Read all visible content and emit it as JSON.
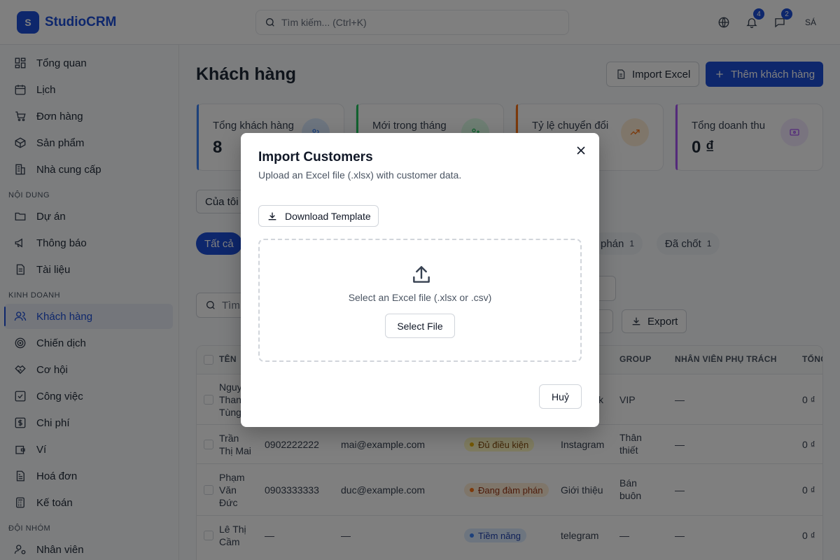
{
  "header": {
    "logo_letter": "S",
    "app_name": "StudioCRM",
    "search_placeholder": "Tìm kiếm... (Ctrl+K)",
    "notifications_count": "4",
    "messages_count": "2",
    "user_initials": "SÁ"
  },
  "sidebar": {
    "items_top": [
      "Tổng quan",
      "Lịch",
      "Đơn hàng",
      "Sản phẩm",
      "Nhà cung cấp"
    ],
    "section_content": "NỘI DUNG",
    "items_content": [
      "Dự án",
      "Thông báo",
      "Tài liệu"
    ],
    "section_business": "KINH DOANH",
    "items_business": [
      "Khách hàng",
      "Chiến dịch",
      "Cơ hội",
      "Công việc",
      "Chi phí",
      "Ví",
      "Hoá đơn",
      "Kế toán"
    ],
    "section_team": "ĐỘI NHÓM",
    "items_team": [
      "Nhân viên"
    ],
    "active_item": "Khách hàng"
  },
  "page": {
    "title": "Khách hàng",
    "import_label": "Import Excel",
    "add_label": "Thêm khách hàng",
    "stats": [
      {
        "label": "Tổng khách hàng",
        "value": "8"
      },
      {
        "label": "Mới trong tháng",
        "value": ""
      },
      {
        "label": "Tỷ lệ chuyển đổi",
        "value": ""
      },
      {
        "label": "Tổng doanh thu",
        "value": "0 ₫"
      }
    ],
    "filter_mine": "Của tôi",
    "tab_all": "Tất cả",
    "tab_negotiating": "phán",
    "tab_negotiating_count": "1",
    "tab_closed": "Đã chốt",
    "tab_closed_count": "1",
    "search_short": "Tìm",
    "export_label": "Export"
  },
  "table": {
    "headers": {
      "name": "TÊN",
      "group": "GROUP",
      "staff": "NHÂN VIÊN PHỤ TRÁCH",
      "total": "TỔNG"
    },
    "rows": [
      {
        "name": "Nguy Thanh Tùng",
        "name_lines": [
          "Nguy",
          "Thanh",
          "Tùng"
        ],
        "phone": "",
        "email": "",
        "status": "",
        "source": "k",
        "group": "VIP",
        "group_lines": [
          "VIP"
        ],
        "staff": "—",
        "total": "0 ₫"
      },
      {
        "name": "Trần Thị Mai",
        "name_lines": [
          "Trần",
          "Thị Mai"
        ],
        "phone": "0902222222",
        "email": "mai@example.com",
        "status": "Đủ điều kiện",
        "source": "Instagram",
        "group": "Thân thiết",
        "group_lines": [
          "Thân",
          "thiết"
        ],
        "staff": "—",
        "total": "0 ₫"
      },
      {
        "name": "Phạm Văn Đức",
        "name_lines": [
          "Phạm",
          "Văn",
          "Đức"
        ],
        "phone": "0903333333",
        "email": "duc@example.com",
        "status": "Đang đàm phán",
        "source": "Giới thiệu",
        "group": "Bán buôn",
        "group_lines": [
          "Bán",
          "buôn"
        ],
        "staff": "—",
        "total": "0 ₫"
      },
      {
        "name": "Lê Thị Cầm",
        "name_lines": [
          "Lê Thị",
          "Cầm"
        ],
        "phone": "—",
        "email": "—",
        "status": "Tiềm năng",
        "source": "telegram",
        "group": "—",
        "group_lines": [
          "—"
        ],
        "staff": "—",
        "total": "0 ₫"
      }
    ]
  },
  "modal": {
    "title": "Import Customers",
    "description": "Upload an Excel file (.xlsx) with customer data.",
    "download_label": "Download Template",
    "dropzone_text": "Select an Excel file (.xlsx or .csv)",
    "select_label": "Select File",
    "cancel_label": "Huỷ"
  },
  "colors": {
    "primary": "#1d4ed8",
    "stat_blue": "#3b82f6",
    "stat_green": "#22c55e",
    "stat_orange": "#f97316",
    "stat_purple": "#a855f7",
    "overlay": "rgba(0,0,0,0.5)"
  }
}
